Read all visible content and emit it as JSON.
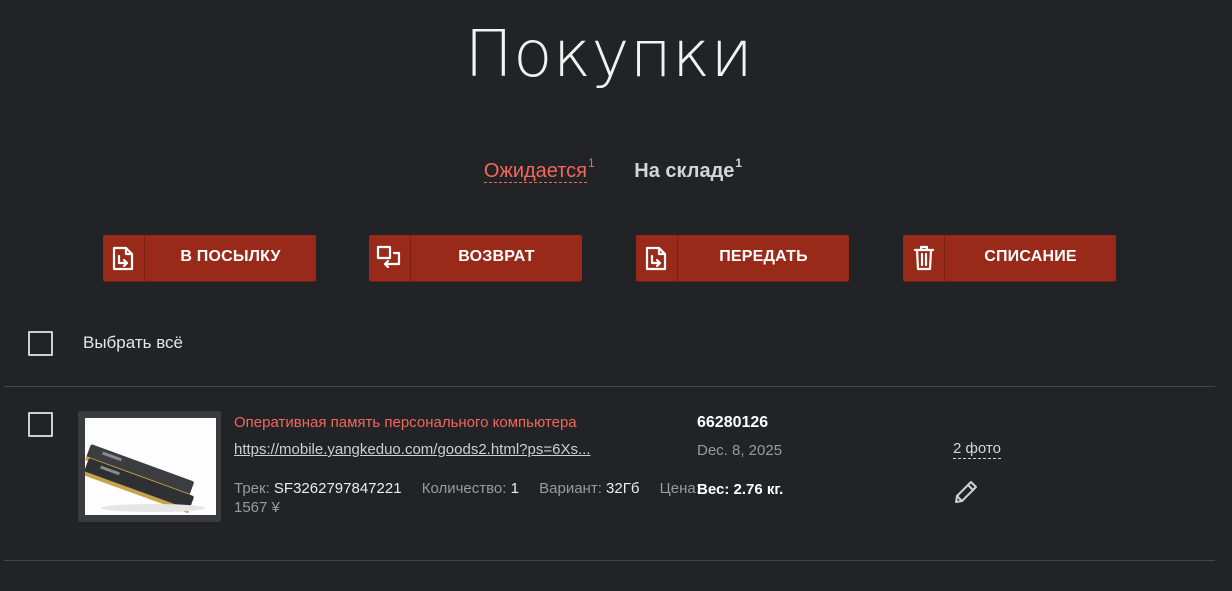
{
  "page": {
    "title": "Покупки"
  },
  "tabs": [
    {
      "label": "Ожидается",
      "count": "1",
      "active": true
    },
    {
      "label": "На складе",
      "count": "1",
      "active": false
    }
  ],
  "actions": [
    {
      "label": "В ПОСЫЛКУ",
      "icon": "into-parcel-icon"
    },
    {
      "label": "ВОЗВРАТ",
      "icon": "return-icon"
    },
    {
      "label": "ПЕРЕДАТЬ",
      "icon": "transfer-icon"
    },
    {
      "label": "СПИСАНИЕ",
      "icon": "trash-icon"
    }
  ],
  "select_all": {
    "label": "Выбрать всё"
  },
  "items": [
    {
      "title": "Оперативная память персонального компьютера",
      "link": "https://mobile.yangkeduo.com/goods2.html?ps=6Xs...",
      "track_label": "Трек:",
      "track": "SF3262797847221",
      "quantity_label": "Количество:",
      "quantity": "1",
      "variant_label": "Вариант:",
      "variant": "32Гб",
      "price_label": "Цена:",
      "price": "1567 ¥",
      "order_number": "66280126",
      "date": "Dec. 8, 2025",
      "weight": "Вес: 2.76 кг.",
      "photos": "2 фото",
      "thumbnail": "ram-module-image"
    }
  ],
  "colors": {
    "background": "#222326",
    "accent": "#f2675a",
    "button": "#992a1a"
  }
}
